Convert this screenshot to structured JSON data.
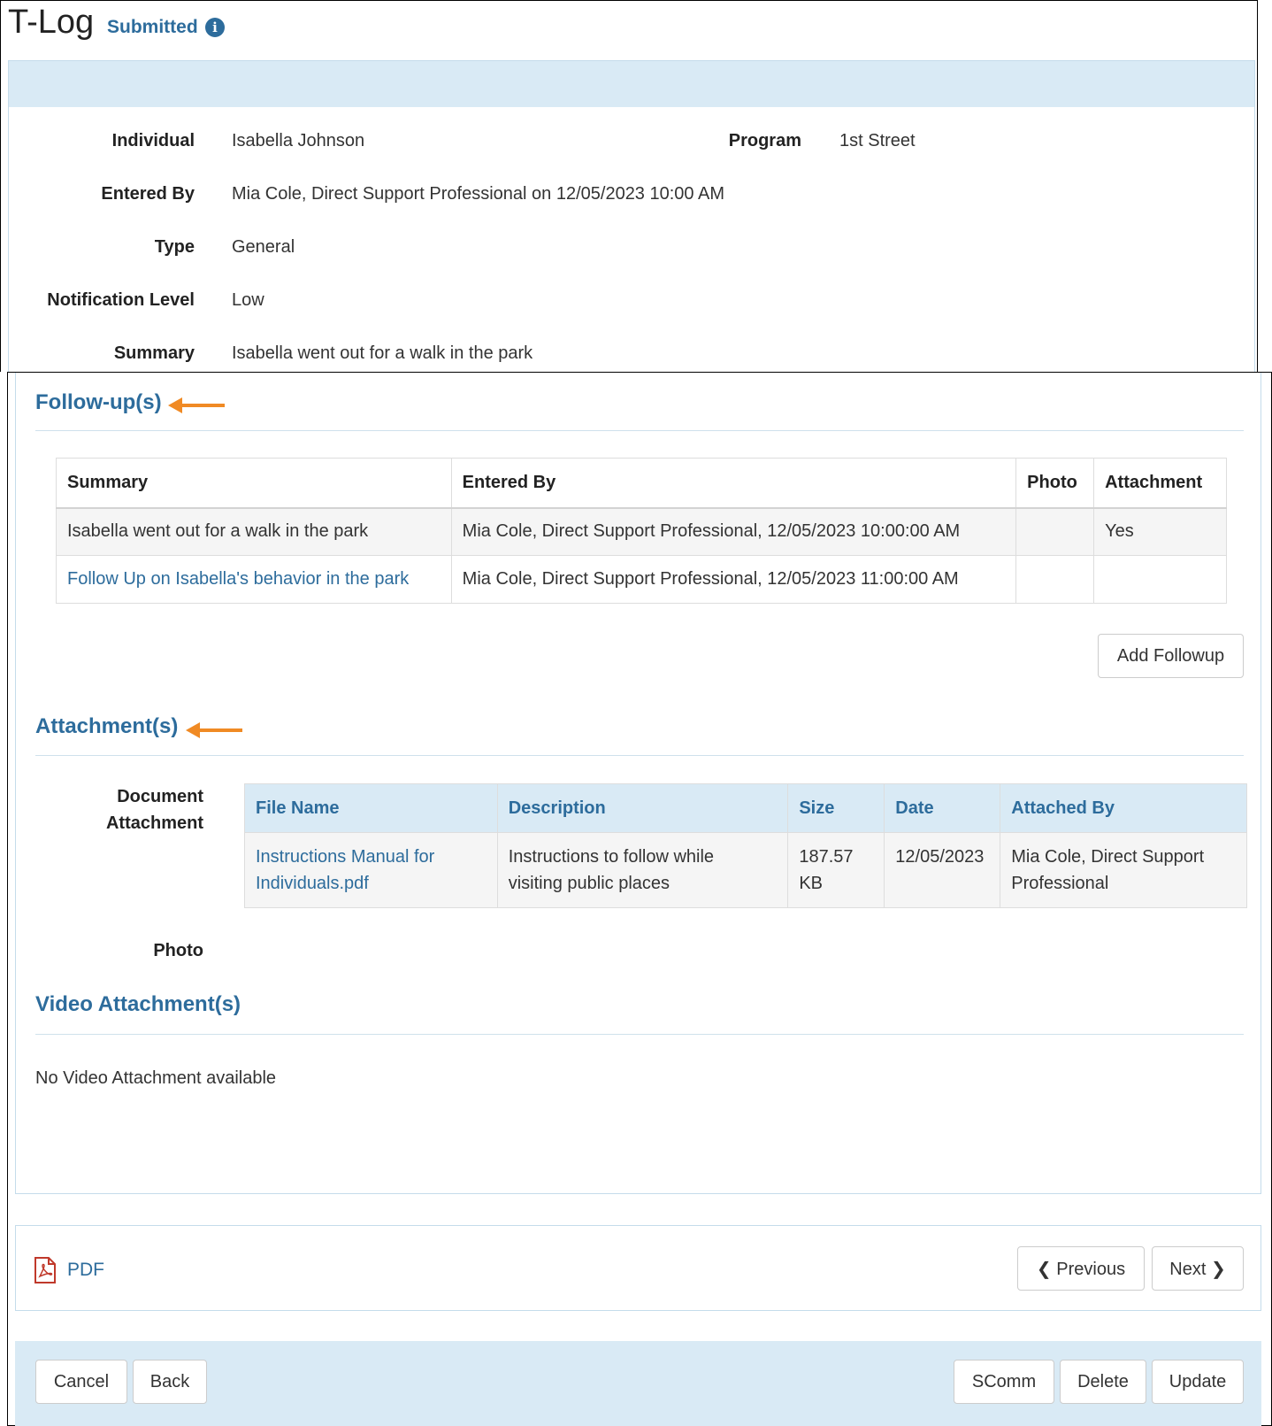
{
  "header": {
    "title": "T-Log",
    "status": "Submitted",
    "info_icon": "info-circle-icon"
  },
  "details": {
    "individual_label": "Individual",
    "individual_value": "Isabella Johnson",
    "program_label": "Program",
    "program_value": "1st Street",
    "entered_by_label": "Entered By",
    "entered_by_value": "Mia Cole, Direct Support Professional on 12/05/2023 10:00 AM",
    "type_label": "Type",
    "type_value": "General",
    "notification_label": "Notification Level",
    "notification_value": "Low",
    "summary_label": "Summary",
    "summary_value": "Isabella went out for a walk in the park"
  },
  "followups": {
    "title": "Follow-up(s)",
    "columns": [
      "Summary",
      "Entered By",
      "Photo",
      "Attachment"
    ],
    "rows": [
      {
        "summary": "Isabella went out for a walk in the park",
        "entered_by": "Mia Cole, Direct Support Professional, 12/05/2023 10:00:00 AM",
        "photo": "",
        "attachment": "Yes"
      },
      {
        "summary": "Follow Up on Isabella's behavior in the park",
        "entered_by": "Mia Cole, Direct Support Professional, 12/05/2023 11:00:00 AM",
        "photo": "",
        "attachment": ""
      }
    ],
    "add_button": "Add Followup"
  },
  "attachments": {
    "title": "Attachment(s)",
    "document_label_line1": "Document",
    "document_label_line2": "Attachment",
    "columns": [
      "File Name",
      "Description",
      "Size",
      "Date",
      "Attached By"
    ],
    "rows": [
      {
        "file_name_line1": "Instructions Manual for",
        "file_name_line2": "Individuals.pdf",
        "description_line1": "Instructions to follow while",
        "description_line2": "visiting public places",
        "size_line1": "187.57",
        "size_line2": "KB",
        "date": "12/05/2023",
        "attached_by_line1": "Mia Cole, Direct Support",
        "attached_by_line2": "Professional"
      }
    ],
    "photo_label": "Photo"
  },
  "video": {
    "title": "Video Attachment(s)",
    "empty_text": "No Video Attachment available"
  },
  "pager": {
    "pdf_label": "PDF",
    "pdf_icon": "pdf-file-icon",
    "previous": "Previous",
    "next": "Next"
  },
  "footer": {
    "cancel": "Cancel",
    "back": "Back",
    "scomm": "SComm",
    "delete": "Delete",
    "update": "Update"
  },
  "colors": {
    "accent": "#2d6c9c",
    "panel_header": "#d9eaf5",
    "annotation_arrow": "#f08a24"
  }
}
